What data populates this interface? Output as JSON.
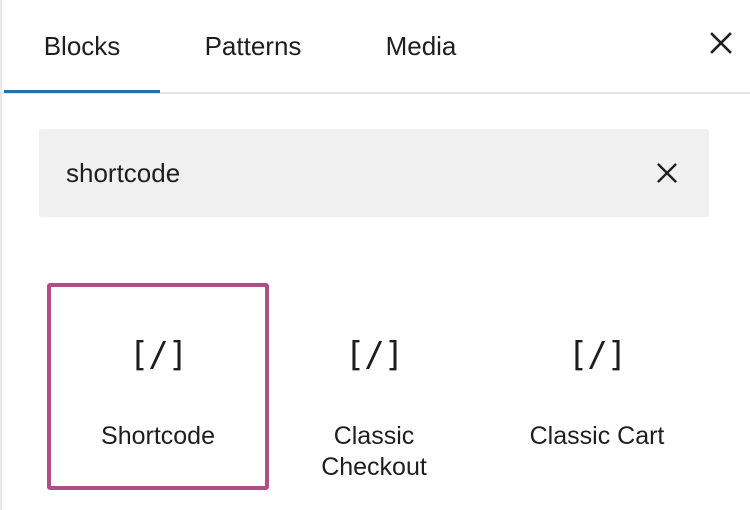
{
  "tabs": [
    {
      "label": "Blocks",
      "active": true
    },
    {
      "label": "Patterns",
      "active": false
    },
    {
      "label": "Media",
      "active": false
    }
  ],
  "close": {
    "icon": "close-icon"
  },
  "search": {
    "value": "shortcode",
    "clear_icon": "close-icon"
  },
  "results": [
    {
      "icon_text": "[/]",
      "icon": "shortcode-icon",
      "label": "Shortcode",
      "selected": true
    },
    {
      "icon_text": "[/]",
      "icon": "shortcode-icon",
      "label": "Classic Checkout",
      "selected": false
    },
    {
      "icon_text": "[/]",
      "icon": "shortcode-icon",
      "label": "Classic Cart",
      "selected": false
    }
  ],
  "colors": {
    "accent": "#2271b1",
    "selection": "#b04f87",
    "search_bg": "#f0f0f0",
    "text": "#1e1e1e"
  }
}
